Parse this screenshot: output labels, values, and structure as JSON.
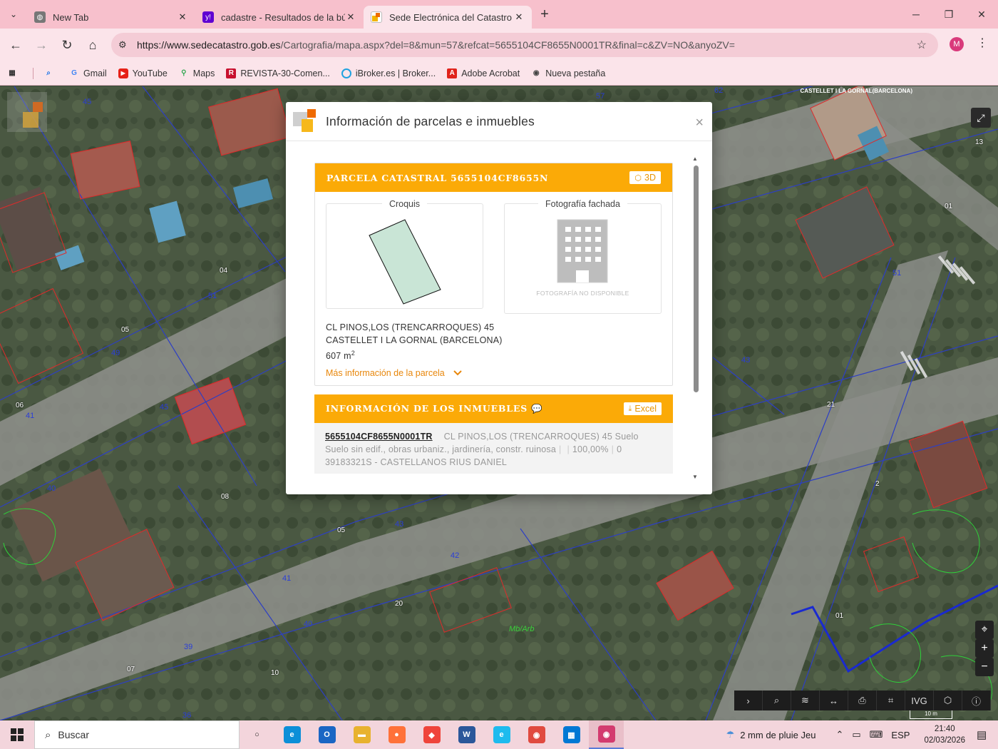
{
  "tabs": [
    {
      "title": "New Tab",
      "favicon": "globe-icon"
    },
    {
      "title": "cadastre - Resultados de la bús",
      "favicon": "yahoo-icon"
    },
    {
      "title": "Sede Electrónica del Catastro -",
      "favicon": "catastro-icon"
    }
  ],
  "address_bar": {
    "url_host": "https://www.sedecatastro.gob.es",
    "url_path": "/Cartografia/mapa.aspx?del=8&mun=57&refcat=5655104CF8655N0001TR&final=c&ZV=NO&anyoZV=",
    "profile_initial": "M"
  },
  "bookmarks": [
    {
      "label": "Gmail",
      "icon": "google-icon",
      "color": "#4285f4"
    },
    {
      "label": "YouTube",
      "icon": "youtube-icon",
      "color": "#e62117"
    },
    {
      "label": "Maps",
      "icon": "maps-pin-icon",
      "color": "#34a853"
    },
    {
      "label": "REVISTA-30-Comen...",
      "icon": "revista-icon",
      "color": "#c8102e"
    },
    {
      "label": "iBroker.es | Broker...",
      "icon": "ibroker-icon",
      "color": "#1fa2e0"
    },
    {
      "label": "Adobe Acrobat",
      "icon": "acrobat-icon",
      "color": "#e0231b"
    },
    {
      "label": "Nueva pestaña",
      "icon": "chrome-icon",
      "color": "#444444"
    }
  ],
  "map": {
    "caption": "CASTELLET I LA GORNAL(BARCELONA)",
    "scale_label": "10 m",
    "blue_labels": [
      "45",
      "57",
      "62",
      "51",
      "49",
      "41",
      "45",
      "40",
      "43",
      "42",
      "41",
      "40",
      "39",
      "36",
      "51",
      "43"
    ],
    "white_labels": [
      "04",
      "05",
      "06",
      "08",
      "05",
      "20",
      "07",
      "10",
      "21",
      "01",
      "01",
      "13",
      "2"
    ],
    "green_label": "Mb/Arb",
    "tool_labels": [
      "chevron-right-icon",
      "search-icon",
      "layers-icon",
      "measure-icon",
      "print-icon",
      "parcel-icon",
      "IVG",
      "3d-icon",
      "info-icon"
    ]
  },
  "dialog": {
    "title": "Información de parcelas e inmuebles",
    "parcela": {
      "heading": "PARCELA CATASTRAL 5655104CF8655N",
      "button_3d": "3D",
      "croquis_label": "Croquis",
      "foto_label": "Fotografía fachada",
      "no_photo": "FOTOGRAFÍA NO DISPONIBLE",
      "address_line1": "CL PINOS,LOS (TRENCARROQUES) 45",
      "address_line2": "CASTELLET I LA GORNAL (BARCELONA)",
      "area_value": "607 m",
      "area_sup": "2",
      "more_info": "Más información de la parcela"
    },
    "inmuebles": {
      "heading": "INFORMACIÓN DE LOS INMUEBLES",
      "excel_button": "Excel",
      "rows": [
        {
          "ref": "5655104CF8655N0001TR",
          "address": "CL PINOS,LOS (TRENCARROQUES) 45 Suelo",
          "use": "Suelo sin edif., obras urbaniz., jardinería, constr. ruinosa",
          "share": "100,00%",
          "count": "0",
          "owner": "39183321S - CASTELLANOS RIUS DANIEL"
        }
      ]
    }
  },
  "taskbar": {
    "search_placeholder": "Buscar",
    "weather": "2 mm de pluie Jeu",
    "language": "ESP",
    "time": "21:40",
    "date": "02/03/2026",
    "apps": [
      {
        "name": "task-view-icon",
        "color": "#222222",
        "glyph": "○"
      },
      {
        "name": "edge-icon",
        "color": "#0c8fd8",
        "glyph": "e"
      },
      {
        "name": "outlook-icon",
        "color": "#1a66c4",
        "glyph": "O"
      },
      {
        "name": "file-explorer-icon",
        "color": "#e8b22e",
        "glyph": "▬"
      },
      {
        "name": "firefox-icon",
        "color": "#ff7139",
        "glyph": "●"
      },
      {
        "name": "anydesk-icon",
        "color": "#ef443b",
        "glyph": "◆"
      },
      {
        "name": "word-icon",
        "color": "#2b579a",
        "glyph": "W"
      },
      {
        "name": "internet-explorer-icon",
        "color": "#1ebbee",
        "glyph": "e"
      },
      {
        "name": "chrome-icon",
        "color": "#e04a3f",
        "glyph": "◉"
      },
      {
        "name": "store-icon",
        "color": "#0078d4",
        "glyph": "▦"
      },
      {
        "name": "chrome-profile-icon",
        "color": "#d33b6f",
        "glyph": "◉"
      }
    ]
  },
  "colors": {
    "accent_orange": "#fbaa07",
    "link_orange": "#e8870c",
    "chrome_pink": "#f7c0cc"
  }
}
